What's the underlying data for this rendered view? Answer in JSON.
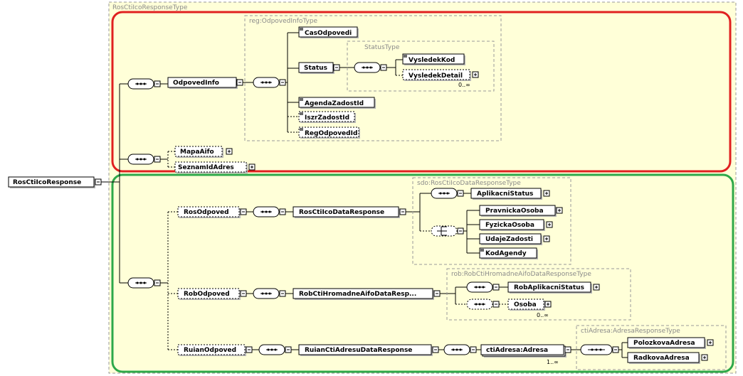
{
  "root": {
    "label": "RosCtiIcoResponse"
  },
  "root_type": {
    "label": "RosCtiIcoResponseType"
  },
  "odpoved_info_type": {
    "label": "reg:OdpovedInfoType"
  },
  "status_type": {
    "label": "StatusType"
  },
  "data_response_type": {
    "label": "sdo:RosCtiIcoDataResponseType"
  },
  "hromadne_type": {
    "label": "rob:RobCtiHromadneAifoDataResponseType"
  },
  "adresa_type": {
    "label": "ctiAdresa:AdresaResponseType"
  },
  "elements": {
    "odpoved_info": "OdpovedInfo",
    "cas_odpovedi": "CasOdpovedi",
    "status": "Status",
    "vysledek_kod": "VysledekKod",
    "vysledek_detail": "VysledekDetail",
    "agenda_zadost_id": "AgendaZadostId",
    "iszr_zadost_id": "IszrZadostId",
    "reg_odpoved_id": "RegOdpovedId",
    "mapa_aifo": "MapaAifo",
    "seznam_id_adres": "SeznamIdAdres",
    "ros_odpoved": "RosOdpoved",
    "ros_cti_ico_data_response": "RosCtiIcoDataResponse",
    "aplikacni_status": "AplikacniStatus",
    "pravnicka_osoba": "PravnickaOsoba",
    "fyzicka_osoba": "FyzickaOsoba",
    "udaje_zadosti": "UdajeZadosti",
    "kod_agendy": "KodAgendy",
    "rob_odpoved": "RobOdpoved",
    "rob_cti_hromadne_short": "RobCtiHromadneAifoDataResp...",
    "rob_aplikacni_status": "RobAplikacniStatus",
    "osoba": "Osoba",
    "ruian_odpoved": "RuianOdpoved",
    "ruian_cti_adresu_data_response": "RuianCtiAdresuDataResponse",
    "cti_adresa_adresa": "ctiAdresa:Adresa",
    "polozkova_adresa": "PolozkovaAdresa",
    "radkova_adresa": "RadkovaAdresa"
  },
  "occurrences": {
    "vysledek_detail": "0..∞",
    "osoba": "0..∞",
    "cti_adresa": "1..∞"
  },
  "colors": {
    "type_background": "#ffffd8",
    "highlight_red": "#e02020",
    "highlight_green": "#2ea84a",
    "element_border": "#000000",
    "type_border": "#9a9a9a"
  }
}
